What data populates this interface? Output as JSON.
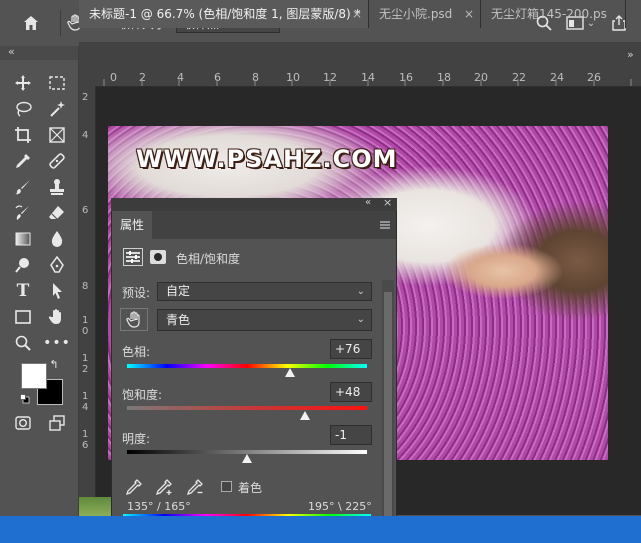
{
  "options_bar": {
    "sample_size_label": "取样大小:",
    "sample_size_value": "取样点"
  },
  "tabs": [
    {
      "label": "未标题-1 @ 66.7% (色相/饱和度 1, 图层蒙版/8) *",
      "close": "×"
    },
    {
      "label": "无尘小院.psd",
      "close": "×"
    },
    {
      "label": "无尘灯箱145-200.ps",
      "close": ""
    }
  ],
  "ruler_h": [
    "0",
    "2",
    "4",
    "6",
    "8",
    "10",
    "12",
    "14",
    "16",
    "18",
    "20",
    "22",
    "24",
    "26"
  ],
  "ruler_v": [
    "2",
    "4",
    "6",
    "8",
    "1\n0",
    "1\n2",
    "1\n4",
    "1\n6"
  ],
  "canvas": {
    "watermark": "WWW.PSAHZ.COM"
  },
  "properties": {
    "tab_label": "属性",
    "adjustment_title": "色相/饱和度",
    "preset_label": "预设:",
    "preset_value": "自定",
    "channel_value": "青色",
    "hue_label": "色相:",
    "hue_value": "+76",
    "hue_fraction": 0.68,
    "saturation_label": "饱和度:",
    "saturation_value": "+48",
    "saturation_fraction": 0.74,
    "lightness_label": "明度:",
    "lightness_value": "-1",
    "lightness_fraction": 0.5,
    "colorize_label": "着色",
    "range_left": "135° / 165°",
    "range_right": "195° \\ 225°"
  },
  "colors": {
    "accent_blue": "#1f6fd1",
    "panel_bg": "#535353",
    "dark_bg": "#282828"
  },
  "icons": [
    "home-icon",
    "eyedropper-hand-icon",
    "search-icon",
    "workspace-icon",
    "share-icon"
  ]
}
